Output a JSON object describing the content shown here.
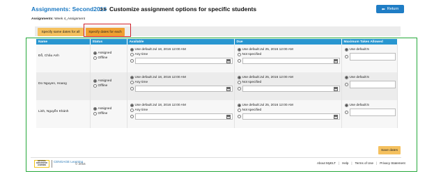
{
  "header": {
    "assignments_label": "Assignments: Second2016",
    "separator": ">>",
    "title": "Customize assignment options for specific students",
    "return_label": "Return",
    "return_icon": "arrow-left-icon"
  },
  "breadcrumb": {
    "label": "Assignments:",
    "value": "Week 4_Assignment"
  },
  "tabs": {
    "same": "Specify same dates for all",
    "each": "Specify dates for each"
  },
  "columns": [
    "Name",
    "Status",
    "Available",
    "Due",
    "Maximum Takes Allowed"
  ],
  "rows": [
    {
      "name": "Đỗ, Châu Anh",
      "status_assigned": "Assigned",
      "status_offline": "Offline",
      "avail_default": "Use default:Jul 18, 2016 12:00 AM",
      "avail_any": "Any time",
      "due_default": "Use default:Jul 25, 2016 12:00 AM",
      "due_none": "Not specified",
      "max_default": "Use default:5"
    },
    {
      "name": "Do Nguyen, Hoang",
      "status_assigned": "Assigned",
      "status_offline": "Offline",
      "avail_default": "Use default:Jul 18, 2016 12:00 AM",
      "avail_any": "Any time",
      "due_default": "Use default:Jul 25, 2016 12:00 AM",
      "due_none": "Not specified",
      "max_default": "Use default:5"
    },
    {
      "name": "Linh, Nguyễn Khánh",
      "status_assigned": "Assigned",
      "status_offline": "Offline",
      "avail_default": "Use default:Jul 18, 2016 12:00 AM",
      "avail_any": "Any time",
      "due_default": "Use default:Jul 25, 2016 12:00 AM",
      "due_none": "Not specified",
      "max_default": "Use default:5"
    }
  ],
  "save_label": "Save dates",
  "footer": {
    "ng_logo": "NATIONAL GEOGRAPHIC LEARNING",
    "cengage_logo": "CENGAGE Learning",
    "copyright": "© 2016",
    "links": [
      "About MyELT",
      "Help",
      "Terms of Use",
      "Privacy Statement"
    ]
  },
  "colors": {
    "accent_blue": "#1f7dc5",
    "header_blue": "#2896d0",
    "tab_orange": "#f0a032",
    "tab_yellow": "#f5c15f",
    "highlight_red": "#d0202a",
    "highlight_green": "#25a83a"
  }
}
